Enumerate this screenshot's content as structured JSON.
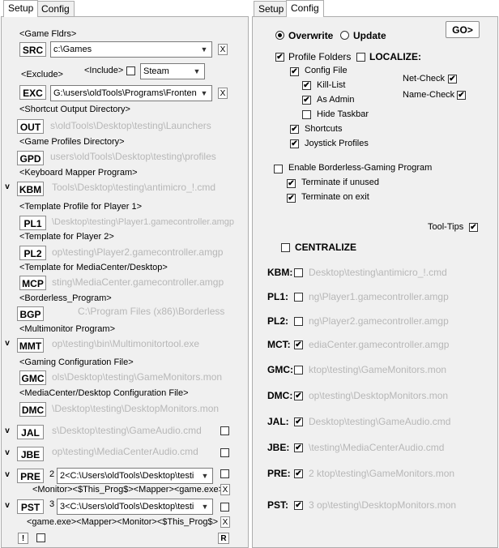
{
  "left": {
    "tabs": [
      "Setup",
      "Config"
    ],
    "labels": {
      "game_fldrs": "<Game Fldrs>",
      "exclude": "<Exclude>",
      "include": "<Include>",
      "shortcut_out": "<Shortcut Output Directory>",
      "game_profiles": "<Game Profiles Directory>",
      "kbm": "<Keyboard Mapper Program>",
      "pl1": "<Template Profile for Player 1>",
      "pl2": "<Template for Player 2>",
      "mcp": "<Template for MediaCenter/Desktop>",
      "bgp": "<Borderless_Program>",
      "mmt": "<Multimonitor Program>",
      "gmc": "<Gaming Configuration File>",
      "dmc": "<MediaCenter/Desktop Configuration File>"
    },
    "buttons": {
      "src": "SRC",
      "exc": "EXC",
      "out": "OUT",
      "gpd": "GPD",
      "kbm": "KBM",
      "pl1": "PL1",
      "pl2": "PL2",
      "mcp": "MCP",
      "bgp": "BGP",
      "mmt": "MMT",
      "gmc": "GMC",
      "dmc": "DMC",
      "jal": "JAL",
      "jbe": "JBE",
      "pre": "PRE",
      "pst": "PST",
      "x": "X",
      "bang": "!",
      "r": "R"
    },
    "fields": {
      "src_combo": "c:\\Games",
      "include_combo": "Steam",
      "exc_combo": "G:\\users\\oldTools\\Programs\\Fronten",
      "out_path": "s\\oldTools\\Desktop\\testing\\Launchers",
      "gpd_path": "users\\oldTools\\Desktop\\testing\\profiles",
      "kbm_path": "Tools\\Desktop\\testing\\antimicro_!.cmd",
      "pl1_path": "\\Desktop\\testing\\Player1.gamecontroller.amgp",
      "pl2_path": "op\\testing\\Player2.gamecontroller.amgp",
      "mcp_path": "sting\\MediaCenter.gamecontroller.amgp",
      "bgp_path": "C:\\Program Files (x86)\\Borderless",
      "mmt_path": "op\\testing\\bin\\Multimonitortool.exe",
      "gmc_path": "ols\\Desktop\\testing\\GameMonitors.mon",
      "dmc_path": "\\Desktop\\testing\\DesktopMonitors.mon",
      "jal_path": "s\\Desktop\\testing\\GameAudio.cmd",
      "jbe_path": "op\\testing\\MediaCenterAudio.cmd",
      "pre_num": "2",
      "pre_combo": "2<C:\\Users\\oldTools\\Desktop\\testi",
      "pre_sub": "<Monitor><$This_Prog$><Mapper><game.exe>",
      "pst_num": "3",
      "pst_combo": "3<C:\\Users\\oldTools\\Desktop\\testi",
      "pst_sub": "<game.exe><Mapper><Monitor><$This_Prog$>"
    },
    "checkmark": "v"
  },
  "right": {
    "tabs": [
      "Setup",
      "Config"
    ],
    "overwrite": "Overwrite",
    "update": "Update",
    "go": "GO>",
    "profile_folders": "Profile Folders",
    "localize": "LOCALIZE:",
    "config_file": "Config File",
    "kill_list": "Kill-List",
    "as_admin": "As Admin",
    "hide_taskbar": "Hide Taskbar",
    "shortcuts": "Shortcuts",
    "joystick_profiles": "Joystick Profiles",
    "net_check": "Net-Check",
    "name_check": "Name-Check",
    "enable_borderless": "Enable Borderless-Gaming Program",
    "terminate_unused": "Terminate if unused",
    "terminate_exit": "Terminate on exit",
    "tool_tips": "Tool-Tips",
    "centralize": "CENTRALIZE",
    "rows": [
      {
        "label": "KBM:",
        "path": "Desktop\\testing\\antimicro_!.cmd",
        "checked": false
      },
      {
        "label": "PL1:",
        "path": "ng\\Player1.gamecontroller.amgp",
        "checked": false
      },
      {
        "label": "PL2:",
        "path": "ng\\Player2.gamecontroller.amgp",
        "checked": false
      },
      {
        "label": "MCT:",
        "path": "ediaCenter.gamecontroller.amgp",
        "checked": true
      },
      {
        "label": "GMC:",
        "path": "ktop\\testing\\GameMonitors.mon",
        "checked": false
      },
      {
        "label": "DMC:",
        "path": "op\\testing\\DesktopMonitors.mon",
        "checked": true
      },
      {
        "label": "JAL:",
        "path": "Desktop\\testing\\GameAudio.cmd",
        "checked": true
      },
      {
        "label": "JBE:",
        "path": "\\testing\\MediaCenterAudio.cmd",
        "checked": true
      },
      {
        "label": "PRE:",
        "path": "2  ktop\\testing\\GameMonitors.mon",
        "checked": true
      },
      {
        "label": "PST:",
        "path": "3  op\\testing\\DesktopMonitors.mon",
        "checked": true
      }
    ],
    "checkmark": "✔"
  }
}
